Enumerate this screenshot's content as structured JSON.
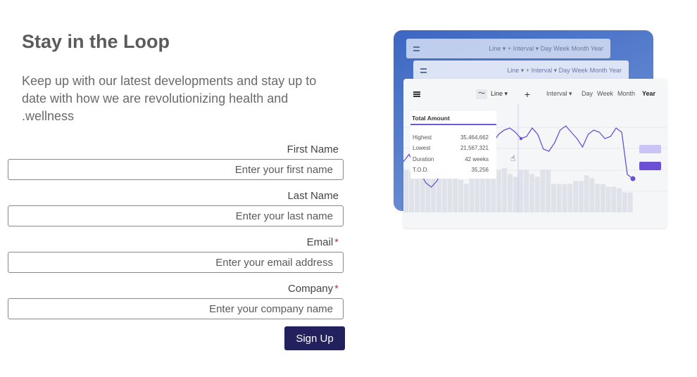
{
  "heading": "Stay in the Loop",
  "lead": "Keep up with our latest developments and stay up to date with how we are revolutionizing health and .wellness",
  "form": {
    "first_name": {
      "label": "First Name",
      "placeholder": "Enter your first name"
    },
    "last_name": {
      "label": "Last Name",
      "placeholder": "Enter your last name"
    },
    "email": {
      "label": "Email",
      "required_mark": "*",
      "placeholder": "Enter your email address"
    },
    "company": {
      "label": "Company",
      "required_mark": "*",
      "placeholder": "Enter your company name"
    },
    "submit_label": "Sign Up"
  },
  "illustration": {
    "toolbar": {
      "line_label": "Line ▾",
      "plus_icon": "plus-icon",
      "interval_label": "Interval ▾",
      "day": "Day",
      "week": "Week",
      "month": "Month",
      "year": "Year"
    },
    "back_toolbar_1": "Line ▾   +   Interval ▾     Day  Week  Month  Year",
    "back_toolbar_2": "Line ▾   +      Interval ▾     Day  Week  Month  Year",
    "stats": {
      "title": "Total Amount",
      "rows": [
        {
          "key": "Highest",
          "value": "35,464,662"
        },
        {
          "key": "Lowest",
          "value": "21,567,321"
        },
        {
          "key": "Duration",
          "value": "42 weeks"
        },
        {
          "key": "T.O.D.",
          "value": "35,256"
        }
      ]
    },
    "colors": {
      "line": "#6b50d6",
      "bars": "#dfe2e8",
      "accent": "#23205e",
      "gradient_start": "#3c66c2"
    },
    "chart_data": {
      "type": "line",
      "line_values": [
        48,
        55,
        45,
        38,
        28,
        24,
        30,
        42,
        50,
        62,
        70,
        75,
        72,
        60,
        52,
        55,
        66,
        74,
        78,
        80,
        76,
        70,
        72,
        80,
        74,
        60,
        58,
        66,
        78,
        82,
        76,
        70,
        62,
        74,
        78,
        76,
        70,
        72,
        80,
        76,
        36,
        32
      ],
      "bar_values": [
        30,
        29,
        27,
        25,
        25,
        29,
        26,
        25,
        27,
        29,
        23,
        20,
        27,
        28,
        32,
        33,
        31,
        30,
        31,
        27,
        25,
        30,
        30,
        27,
        25,
        30,
        30,
        20,
        20,
        20,
        20,
        22,
        22,
        26,
        24,
        20,
        20,
        18,
        18,
        17,
        14,
        14
      ]
    }
  }
}
